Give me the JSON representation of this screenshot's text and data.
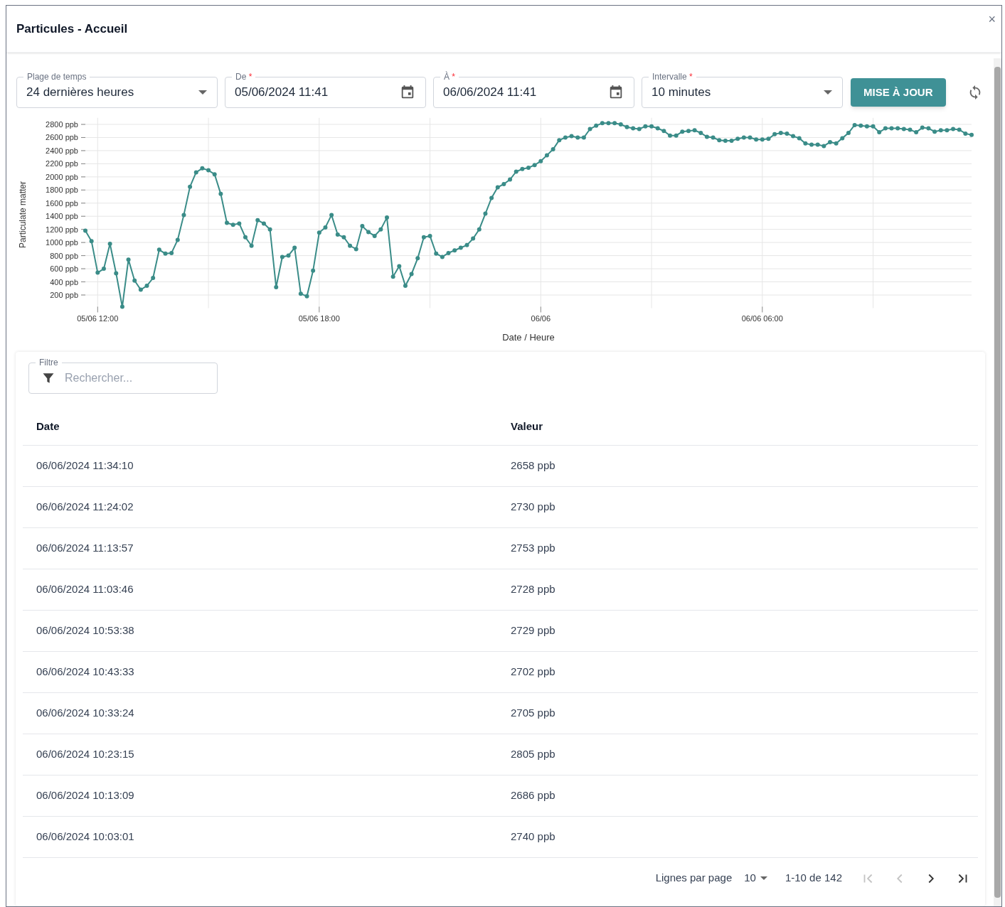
{
  "dialog": {
    "title": "Particules - Accueil",
    "close": "×"
  },
  "fields": [
    {
      "kind": "select",
      "label": "Plage de temps",
      "value": "24 dernières heures"
    },
    {
      "kind": "date",
      "label": "De",
      "required_mark": "*",
      "value": "05/06/2024 11:41"
    },
    {
      "kind": "date",
      "label": "À",
      "required_mark": "*",
      "value": "06/06/2024 11:41"
    },
    {
      "kind": "select",
      "label": "Intervalle",
      "required_mark": "*",
      "value": "10 minutes"
    }
  ],
  "update_button": "MISE À JOUR",
  "chart_data": {
    "type": "line",
    "grid": true,
    "xlabel": "Date / Heure",
    "ylabel": "Particulate matter",
    "categories": [
      null,
      null,
      "05/06 12:00",
      null,
      null,
      null,
      null,
      null,
      null,
      null,
      null,
      null,
      null,
      null,
      null,
      null,
      null,
      null,
      null,
      null,
      null,
      null,
      null,
      null,
      null,
      null,
      null,
      null,
      null,
      null,
      null,
      null,
      null,
      null,
      null,
      null,
      null,
      null,
      "05/06 18:00",
      null,
      null,
      null,
      null,
      null,
      null,
      null,
      null,
      null,
      null,
      null,
      null,
      null,
      null,
      null,
      null,
      null,
      null,
      null,
      null,
      null,
      null,
      null,
      null,
      null,
      null,
      null,
      null,
      null,
      null,
      null,
      null,
      null,
      null,
      null,
      "06/06",
      null,
      null,
      null,
      null,
      null,
      null,
      null,
      null,
      null,
      null,
      null,
      null,
      null,
      null,
      null,
      null,
      null,
      null,
      null,
      null,
      null,
      null,
      null,
      null,
      null,
      null,
      null,
      null,
      null,
      null,
      null,
      null,
      null,
      null,
      null,
      "06/06 06:00",
      null,
      null,
      null,
      null,
      null,
      null,
      null,
      null,
      null,
      null,
      null,
      null,
      null,
      null,
      null,
      null,
      null,
      null,
      null,
      null,
      null,
      null,
      null,
      null,
      null,
      null,
      null,
      null,
      null,
      null,
      null,
      null,
      null,
      null
    ],
    "series": [
      {
        "color": "#3a8c88",
        "marker": "circle",
        "values": [
          1180,
          1020,
          540,
          600,
          980,
          530,
          20,
          740,
          420,
          280,
          340,
          460,
          890,
          830,
          840,
          1040,
          1420,
          1850,
          2070,
          2130,
          2100,
          2040,
          1740,
          1300,
          1270,
          1290,
          1080,
          950,
          1340,
          1290,
          1200,
          320,
          780,
          800,
          920,
          220,
          180,
          570,
          1150,
          1230,
          1420,
          1120,
          1080,
          950,
          900,
          1250,
          1160,
          1100,
          1200,
          1380,
          480,
          640,
          340,
          520,
          760,
          1080,
          1100,
          830,
          780,
          840,
          880,
          920,
          960,
          1060,
          1200,
          1440,
          1680,
          1840,
          1890,
          1960,
          2080,
          2120,
          2140,
          2180,
          2240,
          2330,
          2420,
          2560,
          2600,
          2620,
          2600,
          2600,
          2730,
          2780,
          2820,
          2820,
          2820,
          2800,
          2760,
          2740,
          2730,
          2770,
          2770,
          2740,
          2700,
          2630,
          2630,
          2690,
          2700,
          2710,
          2670,
          2610,
          2600,
          2560,
          2550,
          2550,
          2580,
          2600,
          2600,
          2570,
          2570,
          2580,
          2650,
          2670,
          2660,
          2620,
          2590,
          2510,
          2490,
          2490,
          2470,
          2530,
          2510,
          2590,
          2670,
          2790,
          2780,
          2770,
          2770,
          2680,
          2740,
          2740,
          2740,
          2730,
          2720,
          2680,
          2750,
          2740,
          2690,
          2710,
          2710,
          2730,
          2720,
          2660,
          2640
        ]
      }
    ],
    "ylim": [
      0,
      2900
    ],
    "yticks": [
      {
        "value": 200,
        "label": "200 ppb"
      },
      {
        "value": 400,
        "label": "400 ppb"
      },
      {
        "value": 600,
        "label": "600 ppb"
      },
      {
        "value": 800,
        "label": "800 ppb"
      },
      {
        "value": 1000,
        "label": "1000 ppb"
      },
      {
        "value": 1200,
        "label": "1200 ppb"
      },
      {
        "value": 1400,
        "label": "1400 ppb"
      },
      {
        "value": 1600,
        "label": "1600 ppb"
      },
      {
        "value": 1800,
        "label": "1800 ppb"
      },
      {
        "value": 2000,
        "label": "2000 ppb"
      },
      {
        "value": 2200,
        "label": "2200 ppb"
      },
      {
        "value": 2400,
        "label": "2400 ppb"
      },
      {
        "value": 2600,
        "label": "2600 ppb"
      },
      {
        "value": 2800,
        "label": "2800 ppb"
      }
    ]
  },
  "filter": {
    "label": "Filtre",
    "placeholder": "Rechercher..."
  },
  "table": {
    "columns": [
      "Date",
      "Valeur"
    ],
    "rows": [
      [
        "06/06/2024 11:34:10",
        "2658 ppb"
      ],
      [
        "06/06/2024 11:24:02",
        "2730 ppb"
      ],
      [
        "06/06/2024 11:13:57",
        "2753 ppb"
      ],
      [
        "06/06/2024 11:03:46",
        "2728 ppb"
      ],
      [
        "06/06/2024 10:53:38",
        "2729 ppb"
      ],
      [
        "06/06/2024 10:43:33",
        "2702 ppb"
      ],
      [
        "06/06/2024 10:33:24",
        "2705 ppb"
      ],
      [
        "06/06/2024 10:23:15",
        "2805 ppb"
      ],
      [
        "06/06/2024 10:13:09",
        "2686 ppb"
      ],
      [
        "06/06/2024 10:03:01",
        "2740 ppb"
      ]
    ]
  },
  "pagination": {
    "rows_label": "Lignes par page",
    "page_size": "10",
    "range": "1-10 de 142",
    "nav": [
      {
        "kind": "first",
        "disabled": true
      },
      {
        "kind": "prev",
        "disabled": true
      },
      {
        "kind": "next",
        "disabled": false
      },
      {
        "kind": "last",
        "disabled": false
      }
    ]
  }
}
